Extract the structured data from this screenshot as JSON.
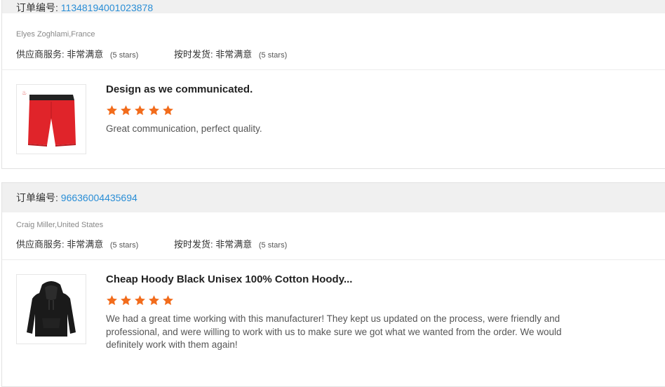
{
  "colors": {
    "accent_link": "#2a8ed6",
    "star": "#f26c1c",
    "header_bg": "#f0f0f0"
  },
  "reviews": [
    {
      "order_label": "订单编号:",
      "order_number": "11348194001023878",
      "buyer": "Elyes Zoghlami,France",
      "supplier_service_label": "供应商服务:",
      "supplier_service_value": "非常满意",
      "supplier_service_stars": "(5 stars)",
      "ontime_label": "按时发货:",
      "ontime_value": "非常满意",
      "ontime_stars": "(5 stars)",
      "product_icon": "red-shorts-image",
      "product_title": "Design as we communicated.",
      "rating": 5,
      "text": "Great communication, perfect quality."
    },
    {
      "order_label": "订单编号:",
      "order_number": "96636004435694",
      "buyer": "Craig Miller,United States",
      "supplier_service_label": "供应商服务:",
      "supplier_service_value": "非常满意",
      "supplier_service_stars": "(5 stars)",
      "ontime_label": "按时发货:",
      "ontime_value": "非常满意",
      "ontime_stars": "(5 stars)",
      "product_icon": "black-hoodie-image",
      "product_title": "Cheap Hoody Black Unisex 100% Cotton Hoody...",
      "rating": 5,
      "text": "We had a great time working with this manufacturer! They kept us updated on the process, were friendly and professional, and were willing to work with us to make sure we got what we wanted from the order. We would definitely work with them again!"
    }
  ]
}
